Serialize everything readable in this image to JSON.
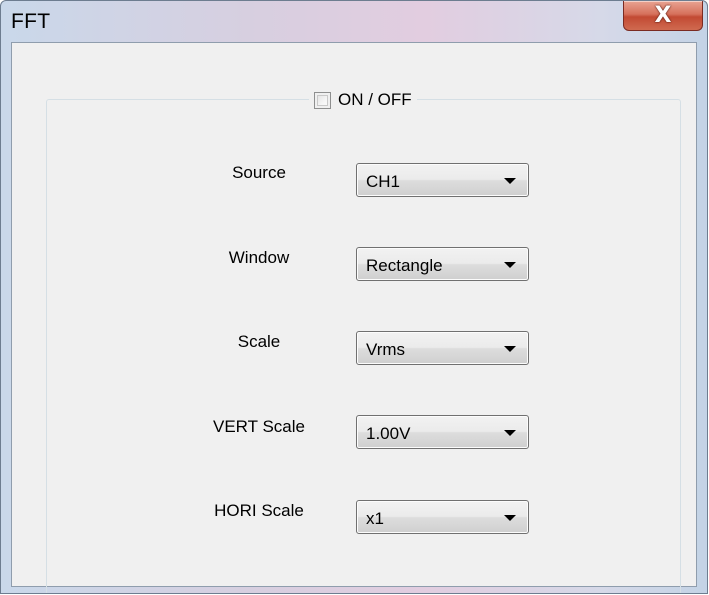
{
  "window": {
    "title": "FFT",
    "close_glyph": "X"
  },
  "fft": {
    "toggle_label": "ON / OFF",
    "toggle_checked": false,
    "fields": [
      {
        "label": "Source",
        "value": "CH1"
      },
      {
        "label": "Window",
        "value": "Rectangle"
      },
      {
        "label": "Scale",
        "value": "Vrms"
      },
      {
        "label": "VERT Scale",
        "value": "1.00V"
      },
      {
        "label": "HORI Scale",
        "value": "x1"
      }
    ]
  },
  "icons": {
    "close": "close-icon",
    "dropdown": "chevron-down-icon",
    "checkbox": "checkbox-icon"
  }
}
